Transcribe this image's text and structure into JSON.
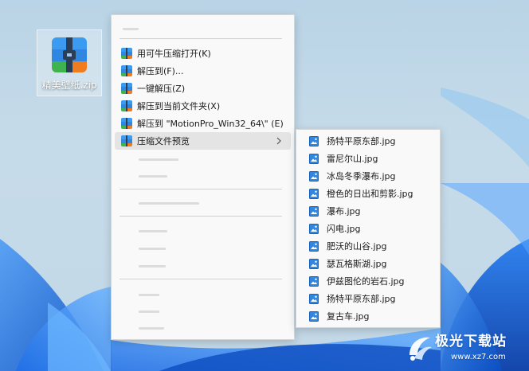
{
  "desktop": {
    "file_label": "精美壁纸.zip"
  },
  "menu": {
    "items": [
      {
        "label": "用可牛压缩打开(K)",
        "icon": "archive-icon"
      },
      {
        "label": "解压到(F)...",
        "icon": "archive-icon"
      },
      {
        "label": "一键解压(Z)",
        "icon": "archive-icon"
      },
      {
        "label": "解压到当前文件夹(X)",
        "icon": "archive-icon"
      },
      {
        "label": "解压到 \"MotionPro_Win32_64\\\" (E)",
        "icon": "archive-icon"
      },
      {
        "label": "压缩文件预览",
        "icon": "archive-icon",
        "has_submenu": true
      }
    ]
  },
  "submenu": {
    "items": [
      "扬特平原东部.jpg",
      "雷尼尔山.jpg",
      "冰岛冬季瀑布.jpg",
      "橙色的日出和剪影.jpg",
      "瀑布.jpg",
      "闪电.jpg",
      "肥沃的山谷.jpg",
      "瑟瓦格斯湖.jpg",
      "伊兹图伦的岩石.jpg",
      "扬特平原东部.jpg",
      "复古车.jpg"
    ]
  },
  "watermark": {
    "brand": "极光下载站",
    "url": "www.xz7.com"
  },
  "colors": {
    "menu_bg": "#f9f9f9",
    "hover_bg": "#e4e4e4",
    "accent_blue": "#2f87e2"
  }
}
